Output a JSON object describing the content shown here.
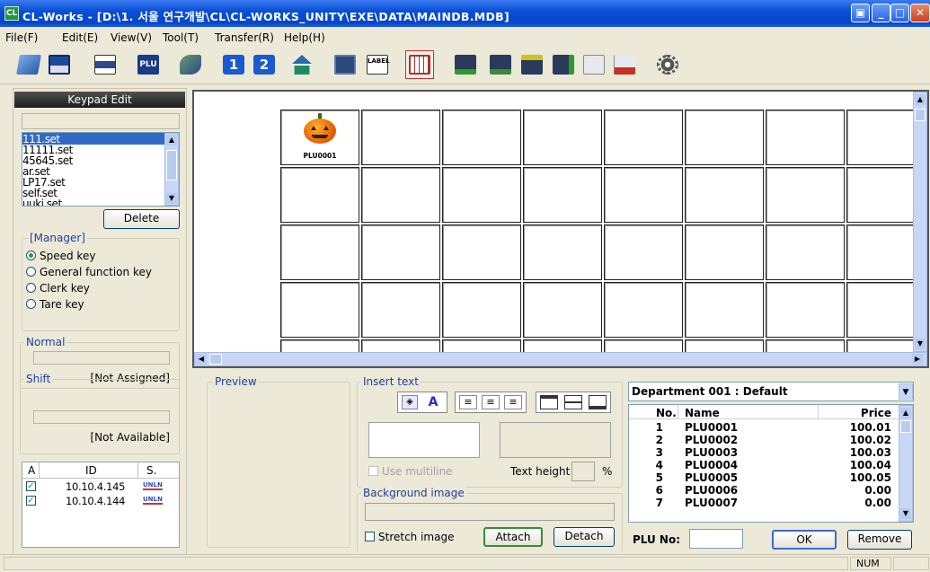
{
  "window": {
    "title": "CL-Works - [D:\\1. 서울 연구개발\\CL\\CL-WORKS_UNITY\\EXE\\DATA\\MAINDB.MDB]",
    "app_icon_text": "CL"
  },
  "menu": [
    "File(F)",
    "Edit(E)",
    "View(V)",
    "Tool(T)",
    "Transfer(R)",
    "Help(H)"
  ],
  "toolbar": {
    "icons": [
      "open-icon",
      "save-icon",
      "print-icon",
      "plu-icon",
      "transfer-icon",
      "one-icon",
      "two-icon",
      "home-icon",
      "keypad-icon",
      "label-icon",
      "grid-icon",
      "send-icon",
      "receive-icon",
      "download-icon",
      "import-icon",
      "export-icon",
      "settings-icon"
    ],
    "plu_text": "PLU",
    "label_text": "LABEL",
    "one_text": "1",
    "two_text": "2"
  },
  "keypad": {
    "header": "Keypad Edit",
    "files": [
      "111.set",
      "11111.set",
      "45645.set",
      "ar.set",
      "LP17.set",
      "self.set",
      "uuki.set"
    ],
    "delete_label": "Delete",
    "manager_label": "[Manager]",
    "options": [
      "Speed key",
      "General function key",
      "Clerk key",
      "Tare key"
    ],
    "selected_option": "Speed key",
    "normal_label": "Normal",
    "normal_status": "[Not Assigned]",
    "shift_label": "Shift",
    "shift_status": "[Not Available]"
  },
  "devices": {
    "headers": [
      "A",
      "ID",
      "S."
    ],
    "rows": [
      {
        "checked": true,
        "id": "10.10.4.145",
        "status": "UNLN"
      },
      {
        "checked": true,
        "id": "10.10.4.144",
        "status": "UNLN"
      }
    ]
  },
  "grid": {
    "first_cell_label": "PLU0001"
  },
  "preview": {
    "label": "Preview"
  },
  "insert_text": {
    "label": "Insert text",
    "use_multiline": "Use multiline",
    "text_height": "Text height",
    "percent": "%",
    "background_image": "Background image",
    "stretch_image": "Stretch image",
    "attach": "Attach",
    "detach": "Detach"
  },
  "plu_list": {
    "department": "Department 001 : Default",
    "headers": {
      "no": "No.",
      "name": "Name",
      "price": "Price"
    },
    "rows": [
      {
        "no": "1",
        "name": "PLU0001",
        "price": "100.01"
      },
      {
        "no": "2",
        "name": "PLU0002",
        "price": "100.02"
      },
      {
        "no": "3",
        "name": "PLU0003",
        "price": "100.03"
      },
      {
        "no": "4",
        "name": "PLU0004",
        "price": "100.04"
      },
      {
        "no": "5",
        "name": "PLU0005",
        "price": "100.05"
      },
      {
        "no": "6",
        "name": "PLU0006",
        "price": "0.00"
      },
      {
        "no": "7",
        "name": "PLU0007",
        "price": "0.00"
      }
    ],
    "plu_no_label": "PLU No:",
    "ok": "OK",
    "remove": "Remove"
  },
  "status": {
    "num": "NUM"
  },
  "colors": {
    "title_bar": "#0a4fd6",
    "selection": "#316ac5",
    "panel_header": "#2a2a2a",
    "group_label": "#2040a0"
  }
}
